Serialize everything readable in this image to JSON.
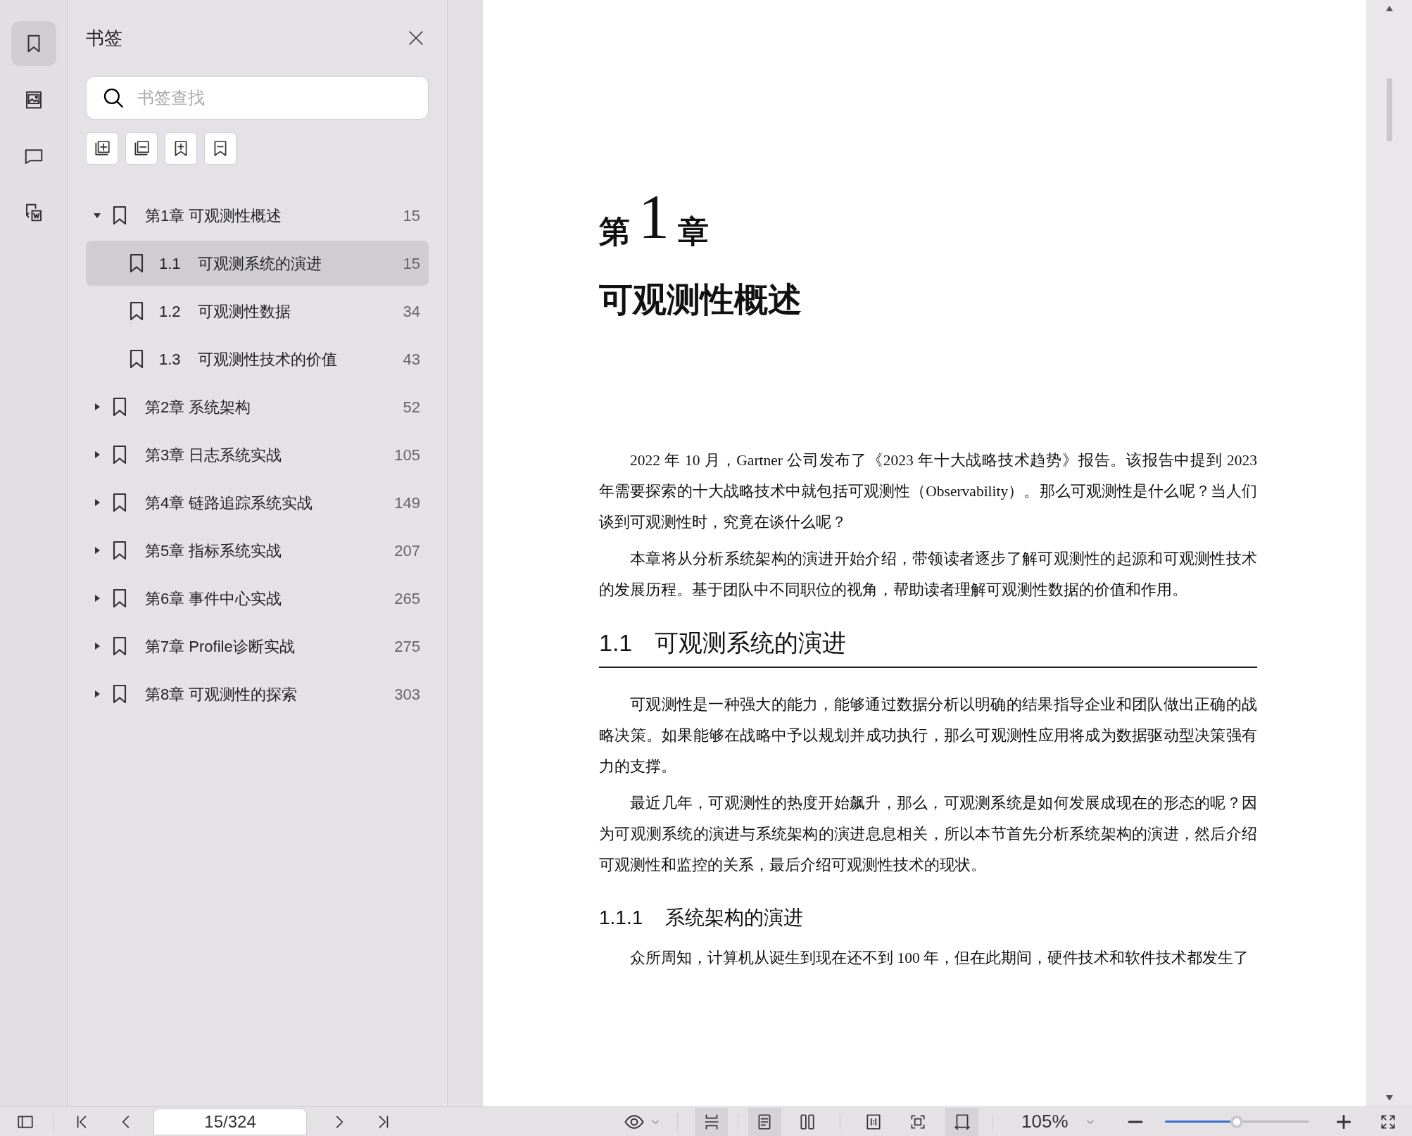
{
  "rail": [
    {
      "kind": "bookmarks",
      "selected": true
    },
    {
      "kind": "images",
      "selected": false
    },
    {
      "kind": "comments",
      "selected": false
    },
    {
      "kind": "convert",
      "selected": false
    }
  ],
  "panel": {
    "title": "书签",
    "search": {
      "placeholder": "书签查找"
    },
    "tools": [
      {
        "kind": "expand-all"
      },
      {
        "kind": "collapse-all"
      },
      {
        "kind": "add"
      },
      {
        "kind": "remove"
      }
    ],
    "bookmarks": [
      {
        "label": "第1章 可观测性概述",
        "page": "15",
        "expanded": true,
        "selected": false,
        "children": [
          {
            "number": "1.1",
            "label": "可观测系统的演进",
            "page": "15",
            "selected": true
          },
          {
            "number": "1.2",
            "label": "可观测性数据",
            "page": "34",
            "selected": false
          },
          {
            "number": "1.3",
            "label": "可观测性技术的价值",
            "page": "43",
            "selected": false
          }
        ]
      },
      {
        "label": "第2章 系统架构",
        "page": "52",
        "expanded": false,
        "selected": false
      },
      {
        "label": "第3章 日志系统实战",
        "page": "105",
        "expanded": false,
        "selected": false
      },
      {
        "label": "第4章 链路追踪系统实战",
        "page": "149",
        "expanded": false,
        "selected": false
      },
      {
        "label": "第5章 指标系统实战",
        "page": "207",
        "expanded": false,
        "selected": false
      },
      {
        "label": "第6章 事件中心实战",
        "page": "265",
        "expanded": false,
        "selected": false
      },
      {
        "label": "第7章 Profile诊断实战",
        "page": "275",
        "expanded": false,
        "selected": false
      },
      {
        "label": "第8章 可观测性的探索",
        "page": "303",
        "expanded": false,
        "selected": false
      }
    ]
  },
  "document": {
    "chapter_prefix": "第",
    "chapter_number": "1",
    "chapter_suffix": "章",
    "chapter_title": "可观测性概述",
    "blocks": [
      {
        "kind": "paragraph",
        "text": "2022 年 10 月，Gartner 公司发布了《2023 年十大战略技术趋势》报告。该报告中提到 2023 年需要探索的十大战略技术中就包括可观测性（Observability）。那么可观测性是什么呢？当人们谈到可观测性时，究竟在谈什么呢？"
      },
      {
        "kind": "paragraph",
        "text": "本章将从分析系统架构的演进开始介绍，带领读者逐步了解可观测性的起源和可观测性技术的发展历程。基于团队中不同职位的视角，帮助读者理解可观测性数据的价值和作用。"
      },
      {
        "kind": "section",
        "number": "1.1",
        "text": "可观测系统的演进"
      },
      {
        "kind": "paragraph",
        "text": "可观测性是一种强大的能力，能够通过数据分析以明确的结果指导企业和团队做出正确的战略决策。如果能够在战略中予以规划并成功执行，那么可观测性应用将成为数据驱动型决策强有力的支撑。"
      },
      {
        "kind": "paragraph",
        "text": "最近几年，可观测性的热度开始飙升，那么，可观测系统是如何发展成现在的形态的呢？因为可观测系统的演进与系统架构的演进息息相关，所以本节首先分析系统架构的演进，然后介绍可观测性和监控的关系，最后介绍可观测性技术的现状。"
      },
      {
        "kind": "subsection",
        "number": "1.1.1",
        "text": "系统架构的演进"
      },
      {
        "kind": "paragraph",
        "text": "众所周知，计算机从诞生到现在还不到 100 年，但在此期间，硬件技术和软件技术都发生了"
      }
    ]
  },
  "toolbar": {
    "page_field": "15/324",
    "zoom": "105%",
    "zoom_slider": {
      "level": 0.5
    },
    "scroll_modes": [
      {
        "kind": "continuous",
        "selected": true
      }
    ],
    "page_modes": [
      {
        "kind": "single",
        "selected": true
      },
      {
        "kind": "double",
        "selected": false
      }
    ],
    "fit_modes": [
      {
        "kind": "actual",
        "selected": false
      },
      {
        "kind": "fit-page",
        "selected": false
      },
      {
        "kind": "fit-width",
        "selected": true
      }
    ]
  }
}
